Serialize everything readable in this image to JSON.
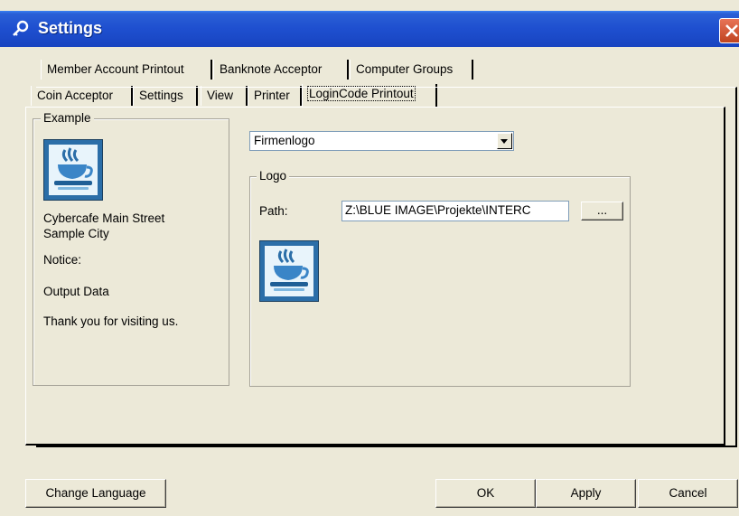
{
  "window": {
    "title": "Settings"
  },
  "tabs_row1": [
    "Member Account Printout",
    "Banknote Acceptor",
    "Computer Groups"
  ],
  "tabs_row2": [
    "Coin Acceptor",
    "Settings",
    "View",
    "Printer",
    "LoginCode Printout"
  ],
  "active_tab": "LoginCode Printout",
  "example": {
    "legend": "Example",
    "line1": "Cybercafe Main Street",
    "line2": "Sample City",
    "notice": "Notice:",
    "output": "Output Data",
    "thanks": "Thank you for visiting us."
  },
  "logo_select": {
    "value": "Firmenlogo"
  },
  "logo": {
    "legend": "Logo",
    "path_label": "Path:",
    "path_value": "Z:\\BLUE IMAGE\\Projekte\\INTERC",
    "browse_label": "..."
  },
  "buttons": {
    "change_language": "Change Language",
    "ok": "OK",
    "apply": "Apply",
    "cancel": "Cancel"
  },
  "colors": {
    "titlebar": "#1e4fcf",
    "close": "#d85c38",
    "dialog": "#ece9d8"
  },
  "icons": [
    "key-icon",
    "close-icon",
    "coffee-cup-icon",
    "dropdown-arrow-icon"
  ]
}
